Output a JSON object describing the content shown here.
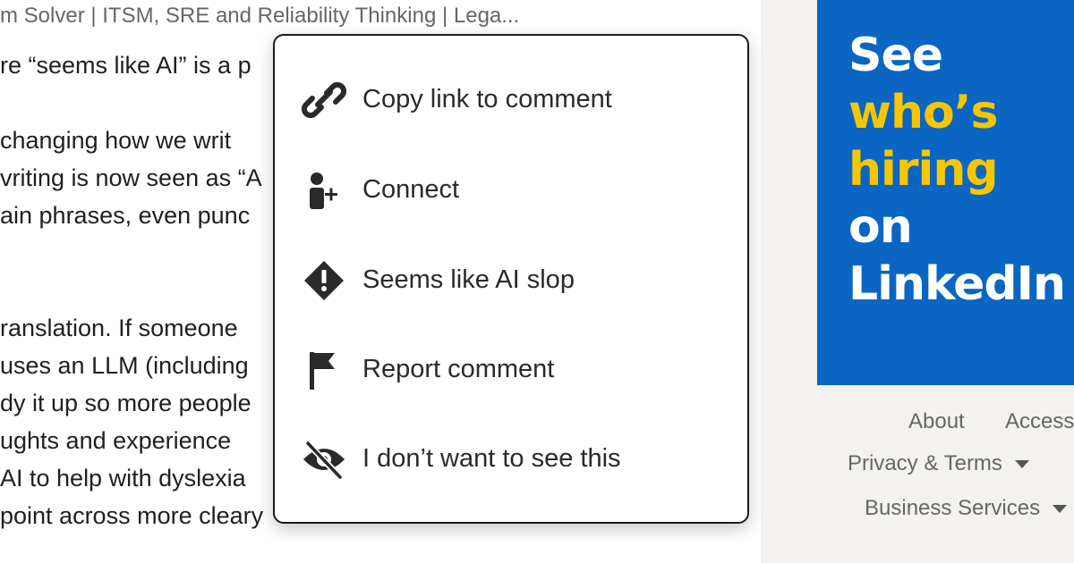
{
  "post": {
    "subtitle": "m Solver | ITSM, SRE and Reliability Thinking | Lega...",
    "lines": [
      "re “seems like AI” is a p",
      "changing how we writ",
      "vriting is now seen as “A",
      "ain phrases, even punc",
      "ranslation. If someone",
      "uses an LLM (including",
      "dy it up so more people",
      "ughts and experience",
      "AI to help with dyslexia",
      "point across more cleary"
    ]
  },
  "menu": {
    "items": [
      {
        "label": "Copy link to comment",
        "icon": "link-icon"
      },
      {
        "label": "Connect",
        "icon": "person-add-icon"
      },
      {
        "label": "Seems like AI slop",
        "icon": "warning-diamond-icon"
      },
      {
        "label": "Report comment",
        "icon": "flag-icon"
      },
      {
        "label": "I don’t want to see this",
        "icon": "eye-slash-icon"
      }
    ]
  },
  "ad": {
    "lines": [
      "See",
      "who’s",
      "hiring",
      "on",
      "LinkedIn"
    ],
    "highlight_color": "#f8c600",
    "text_color": "#ffffff",
    "background": "#0a66c2"
  },
  "footer": {
    "about": "About",
    "accessibility": "Access",
    "privacy": "Privacy & Terms",
    "business": "Business Services"
  }
}
